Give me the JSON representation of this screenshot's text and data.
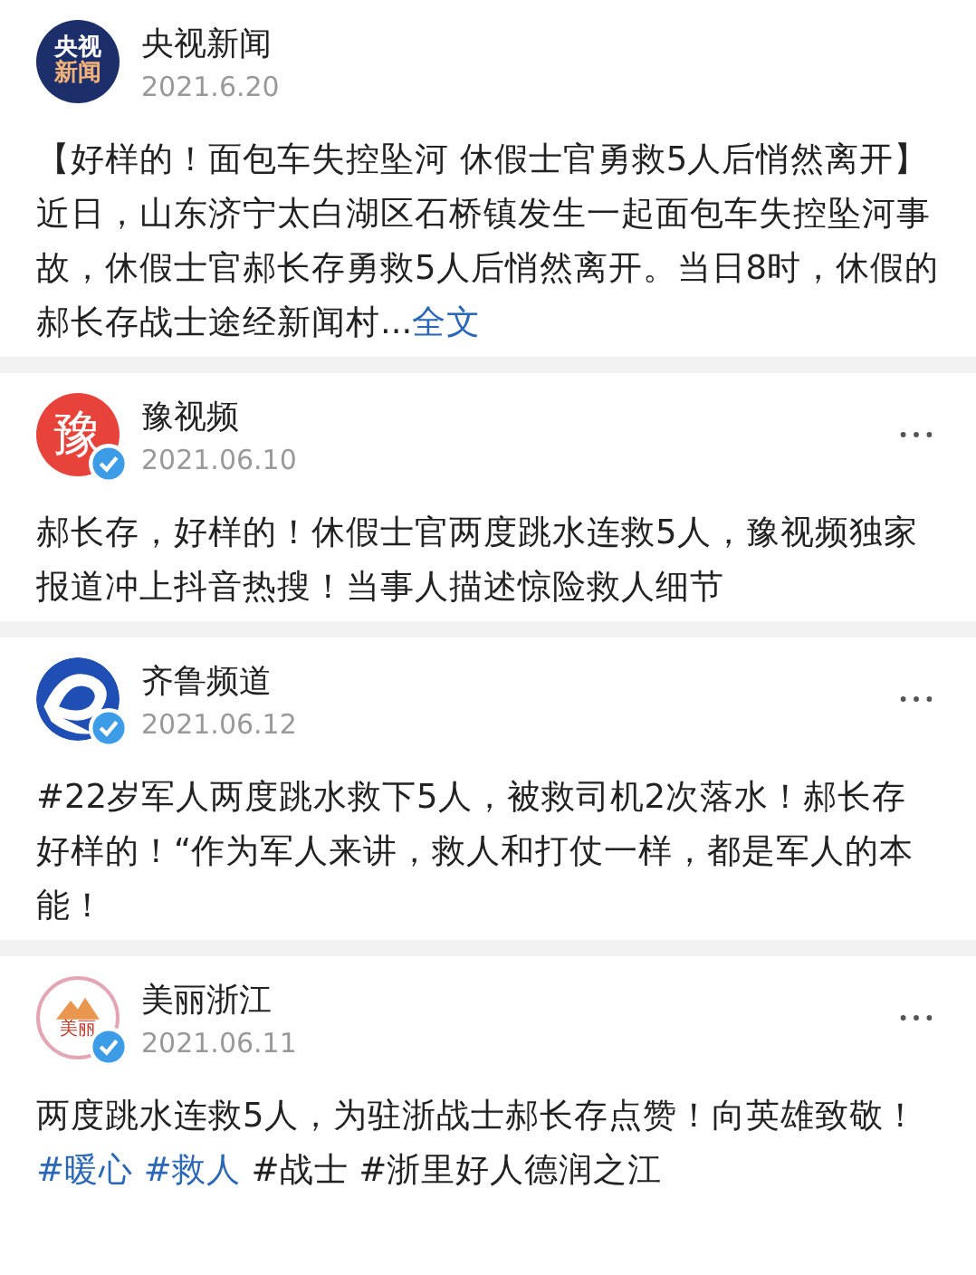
{
  "posts": [
    {
      "avatar": {
        "kind": "cctv",
        "text": [
          "央视",
          "新闻"
        ]
      },
      "name": "央视新闻",
      "date": "2021.6.20",
      "verified": false,
      "menu": false,
      "body": [
        {
          "text": "【好样的！面包车失控坠河 休假士官勇救5人后悄然离开】近日，山东济宁太白湖区石桥镇发生一起面包车失控坠河事故，休假士官郝长存勇救5人后悄然离开。当日8时，休假的郝长存战士途经新闻村...",
          "link": false
        },
        {
          "text": "全文",
          "link": true
        }
      ]
    },
    {
      "avatar": {
        "kind": "yu",
        "text": [
          "豫"
        ]
      },
      "name": "豫视频",
      "date": "2021.06.10",
      "verified": true,
      "menu": true,
      "body": [
        {
          "text": "郝长存，好样的！休假士官两度跳水连救5人，豫视频独家报道冲上抖音热搜！当事人描述惊险救人细节",
          "link": false
        }
      ]
    },
    {
      "avatar": {
        "kind": "qilu"
      },
      "name": "齐鲁频道",
      "date": "2021.06.12",
      "verified": true,
      "menu": true,
      "body": [
        {
          "text": "#22岁军人两度跳水救下5人，被救司机2次落水！郝长存好样的！“作为军人来讲，救人和打仗一样，都是军人的本能！",
          "link": false
        }
      ]
    },
    {
      "avatar": {
        "kind": "meili",
        "text": [
          "美丽"
        ]
      },
      "name": "美丽浙江",
      "date": "2021.06.11",
      "verified": true,
      "menu": true,
      "body": [
        {
          "text": "两度跳水连救5人，为驻浙战士郝长存点赞！向英雄致敬！",
          "link": false
        },
        {
          "text": "#暖心 #救人",
          "link": true
        },
        {
          "text": "  #战士  #浙里好人德润之江",
          "link": false
        }
      ]
    }
  ]
}
